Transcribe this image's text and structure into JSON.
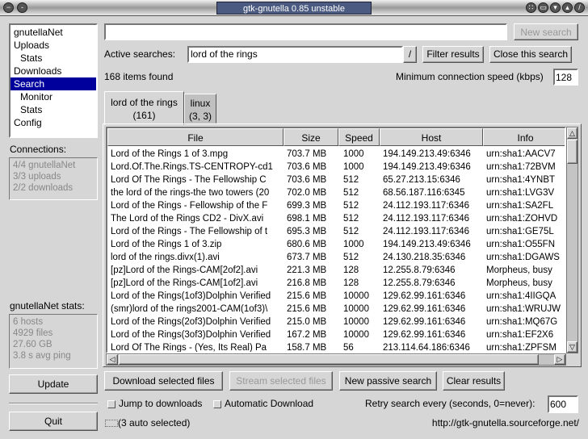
{
  "window": {
    "title": "gtk-gnutella 0.85 unstable"
  },
  "sidebar": {
    "items": [
      {
        "label": "gnutellaNet",
        "level": 0
      },
      {
        "label": "Uploads",
        "level": 0
      },
      {
        "label": "Stats",
        "level": 1
      },
      {
        "label": "Downloads",
        "level": 0
      },
      {
        "label": "Search",
        "level": 0,
        "selected": true
      },
      {
        "label": "Monitor",
        "level": 1
      },
      {
        "label": "Stats",
        "level": 1
      },
      {
        "label": "Config",
        "level": 0
      }
    ],
    "connections_label": "Connections:",
    "connections": [
      "4/4 gnutellaNet",
      "3/3 uploads",
      "2/2 downloads"
    ],
    "stats_label": "gnutellaNet stats:",
    "stats": [
      "6 hosts",
      "4929 files",
      "27.60 GB",
      "3.8 s avg ping"
    ],
    "update_label": "Update",
    "quit_label": "Quit"
  },
  "search": {
    "input_value": "",
    "new_search_label": "New search",
    "active_label": "Active searches:",
    "active_value": "lord of the rings",
    "combo_button": "/",
    "filter_label": "Filter results",
    "close_label": "Close this search",
    "items_found": "168 items found",
    "min_speed_label": "Minimum connection speed (kbps)",
    "min_speed_value": "128",
    "tabs": [
      {
        "title": "lord of the rings",
        "count": "(161)",
        "active": true
      },
      {
        "title": "linux",
        "count": "(3, 3)"
      }
    ]
  },
  "table": {
    "columns": [
      "File",
      "Size",
      "Speed",
      "Host",
      "Info"
    ],
    "rows": [
      [
        "Lord of the Rings 1 of 3.mpg",
        "703.7 MB",
        "1000",
        "194.149.213.49:6346",
        "urn:sha1:AACV7"
      ],
      [
        "Lord.Of.The.Rings.TS-CENTROPY-cd1",
        "703.6 MB",
        "1000",
        "194.149.213.49:6346",
        "urn:sha1:72BVM"
      ],
      [
        "Lord Of The Rings - The Fellowship C",
        "703.6 MB",
        "512",
        "65.27.213.15:6346",
        "urn:sha1:4YNBT"
      ],
      [
        "the lord of the rings-the two towers (20",
        "702.0 MB",
        "512",
        "68.56.187.116:6345",
        "urn:sha1:LVG3V"
      ],
      [
        "Lord of the Rings - Fellowship of the F",
        "699.3 MB",
        "512",
        "24.112.193.117:6346",
        "urn:sha1:SA2FL"
      ],
      [
        "The Lord of the Rings CD2 - DivX.avi",
        "698.1 MB",
        "512",
        "24.112.193.117:6346",
        "urn:sha1:ZOHVD"
      ],
      [
        "Lord of the Rings - The Fellowship of t",
        "695.3 MB",
        "512",
        "24.112.193.117:6346",
        "urn:sha1:GE75L"
      ],
      [
        "Lord of the Rings 1 of 3.zip",
        "680.6 MB",
        "1000",
        "194.149.213.49:6346",
        "urn:sha1:O55FN"
      ],
      [
        "lord of the rings.divx(1).avi",
        "673.7 MB",
        "512",
        "24.130.218.35:6346",
        "urn:sha1:DGAWS"
      ],
      [
        "[pz]Lord of the Rings-CAM[2of2].avi",
        "221.3 MB",
        "128",
        "12.255.8.79:6346",
        "Morpheus, busy"
      ],
      [
        "[pz]Lord of the Rings-CAM[1of2].avi",
        "216.8 MB",
        "128",
        "12.255.8.79:6346",
        "Morpheus, busy"
      ],
      [
        "Lord of the Rings(1of3)Dolphin Verified",
        "215.6 MB",
        "10000",
        "129.62.99.161:6346",
        "urn:sha1:4IIGQA"
      ],
      [
        "(smr)lord of the rings2001-CAM(1of3)\\",
        "215.6 MB",
        "10000",
        "129.62.99.161:6346",
        "urn:sha1:WRUJW"
      ],
      [
        "Lord of the Rings(2of3)Dolphin Verified",
        "215.0 MB",
        "10000",
        "129.62.99.161:6346",
        "urn:sha1:MQ67G"
      ],
      [
        "Lord of the Rings(3of3)Dolphin Verified",
        "167.2 MB",
        "10000",
        "129.62.99.161:6346",
        "urn:sha1:EF2X6"
      ],
      [
        "Lord Of The Rings - (Yes, Its Real) Pa",
        "158.7 MB",
        "56",
        "213.114.64.186:6346",
        "urn:sha1:ZPFSM"
      ]
    ]
  },
  "actions": {
    "download": "Download selected files",
    "stream": "Stream selected files",
    "passive": "New passive search",
    "clear": "Clear results"
  },
  "options": {
    "jump": "Jump to downloads",
    "auto": "Automatic Download",
    "retry_label": "Retry search every (seconds, 0=never):",
    "retry_value": "600"
  },
  "status": {
    "auto_selected": "(3 auto selected)",
    "url": "http://gtk-gnutella.sourceforge.net/"
  },
  "colors": {
    "selection": "#00009c",
    "background": "#d6d6d6"
  }
}
